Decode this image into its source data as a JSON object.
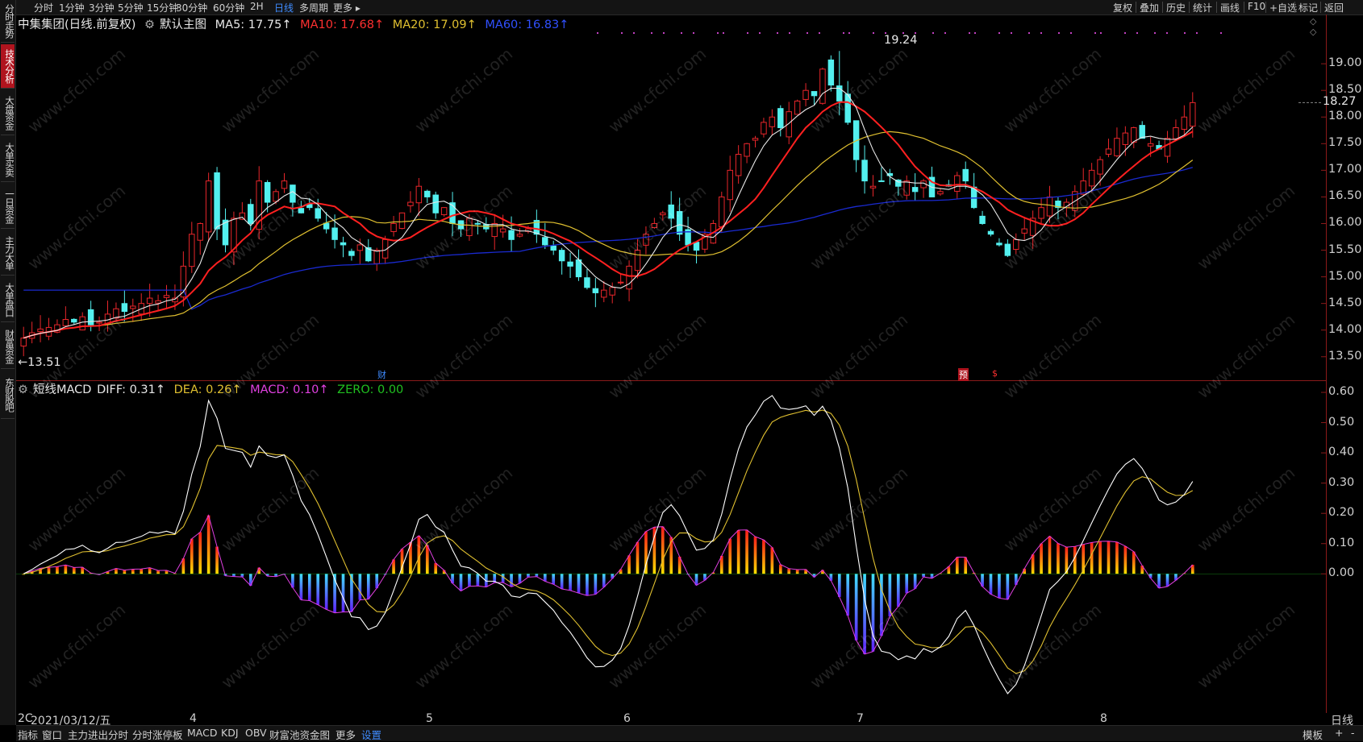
{
  "topbar": {
    "timeframes": [
      "分时",
      "1分钟",
      "3分钟",
      "5分钟",
      "15分钟",
      "30分钟",
      "60分钟",
      "2H",
      "日线",
      "多周期",
      "更多 ▸"
    ],
    "active": "日线",
    "right_tools": [
      "复权",
      "叠加",
      "历史",
      "统计",
      "画线",
      "F10",
      "+自选",
      "标记",
      "返回"
    ]
  },
  "sidebar": {
    "tabs": [
      "分时走势",
      "技术分析",
      "大盘资金",
      "大单买卖",
      "一日资金",
      "主力大单",
      "大单盘口",
      "财富资金",
      "东财股吧"
    ],
    "active": "技术分析"
  },
  "main_legend": {
    "stock": "中集集团(日线.前复权)",
    "chart_name": "默认主图",
    "ma5": "MA5: 17.75↑",
    "ma10": "MA10: 17.68↑",
    "ma20": "MA20: 17.09↑",
    "ma60": "MA60: 16.83↑"
  },
  "macd_legend": {
    "name": "短线MACD",
    "diff": "DIFF: 0.31↑",
    "dea": "DEA: 0.26↑",
    "macd": "MACD: 0.10↑",
    "zero": "ZERO: 0.00"
  },
  "annotations": {
    "high": "19.24",
    "low": "←13.51",
    "price_tag": "18.27",
    "event_cai": "财",
    "event_yu": "预",
    "event_s": "$"
  },
  "x_axis": {
    "date": "2021/03/12/五",
    "prefix": "2C",
    "months": [
      "4",
      "5",
      "6",
      "7",
      "8"
    ],
    "right": "日线"
  },
  "bottom_tabs": [
    "指标",
    "窗口",
    "主力进出分时",
    "分时涨停板",
    "MACD",
    "KDJ",
    "OBV",
    "财富池资金图",
    "更多",
    "设置"
  ],
  "bottom_right": [
    "模板",
    "+",
    "-"
  ],
  "watermark": "www.cfchi.com",
  "colors": {
    "up": "#e8262b",
    "down": "#53f0ef",
    "ma5": "#e8e8e8",
    "ma10": "#ff2020",
    "ma20": "#e0c030",
    "ma60": "#1a2ad0",
    "diff": "#ffffff",
    "dea": "#e0c030",
    "macd": "#e040e0",
    "zero": "#20c020",
    "active": "#3f8cff",
    "frame": "#8b1a1a"
  },
  "chart_data": [
    {
      "type": "candlestick",
      "title": "中集集团(日线.前复权)",
      "y_ticks": [
        19.0,
        18.5,
        18.0,
        17.5,
        17.0,
        16.5,
        16.0,
        15.5,
        15.0,
        14.5,
        14.0,
        13.5
      ],
      "ylim": [
        13.3,
        19.35
      ],
      "x_months": [
        "4",
        "5",
        "6",
        "7",
        "8"
      ],
      "series": [
        {
          "name": "MA5",
          "value_last": 17.75
        },
        {
          "name": "MA10",
          "value_last": 17.68
        },
        {
          "name": "MA20",
          "value_last": 17.09
        },
        {
          "name": "MA60",
          "value_last": 16.83
        }
      ],
      "high": 19.24,
      "low": 13.51,
      "last_close": 18.27,
      "closes": [
        13.85,
        13.95,
        14.02,
        14.05,
        14.1,
        14.2,
        14.15,
        14.25,
        14.1,
        14.15,
        14.3,
        14.4,
        14.35,
        14.45,
        14.5,
        14.6,
        14.55,
        14.65,
        14.6,
        15.2,
        15.8,
        16.0,
        16.8,
        15.9,
        15.6,
        16.1,
        16.2,
        16.0,
        16.8,
        16.4,
        16.6,
        16.8,
        16.4,
        16.2,
        16.3,
        16.1,
        15.9,
        15.7,
        15.6,
        15.4,
        15.6,
        15.3,
        15.5,
        15.7,
        16.0,
        16.2,
        16.4,
        16.7,
        16.5,
        16.2,
        16.3,
        16.0,
        15.9,
        16.1,
        16.0,
        15.9,
        16.0,
        15.9,
        15.7,
        15.8,
        15.9,
        15.8,
        15.6,
        15.5,
        15.3,
        15.2,
        15.0,
        14.8,
        14.7,
        14.75,
        14.8,
        14.9,
        15.2,
        15.5,
        15.8,
        16.0,
        16.2,
        16.1,
        15.8,
        15.6,
        15.5,
        15.8,
        16.0,
        16.5,
        17.0,
        17.3,
        17.5,
        17.6,
        17.9,
        18.0,
        17.8,
        18.1,
        18.3,
        18.5,
        18.4,
        18.9,
        18.6,
        18.3,
        17.9,
        17.2,
        16.8,
        16.7,
        16.8,
        16.9,
        16.7,
        16.8,
        16.6,
        16.8,
        16.5,
        16.6,
        16.7,
        16.9,
        16.8,
        16.3,
        16.0,
        15.8,
        15.6,
        15.4,
        15.7,
        15.9,
        16.1,
        16.3,
        16.5,
        16.3,
        16.4,
        16.6,
        16.8,
        17.0,
        17.2,
        17.4,
        17.6,
        17.7,
        17.8,
        17.6,
        17.5,
        17.4,
        17.6,
        17.8,
        18.0,
        18.27
      ]
    },
    {
      "type": "bar_line",
      "title": "短线MACD",
      "y_ticks": [
        0.6,
        0.5,
        0.4,
        0.3,
        0.2,
        0.1,
        0.0
      ],
      "ylim": [
        -0.46,
        0.64
      ],
      "series": [
        {
          "name": "DIFF",
          "value_last": 0.31
        },
        {
          "name": "DEA",
          "value_last": 0.26
        },
        {
          "name": "MACD",
          "value_last": 0.1
        },
        {
          "name": "ZERO",
          "value_last": 0.0
        }
      ]
    }
  ]
}
